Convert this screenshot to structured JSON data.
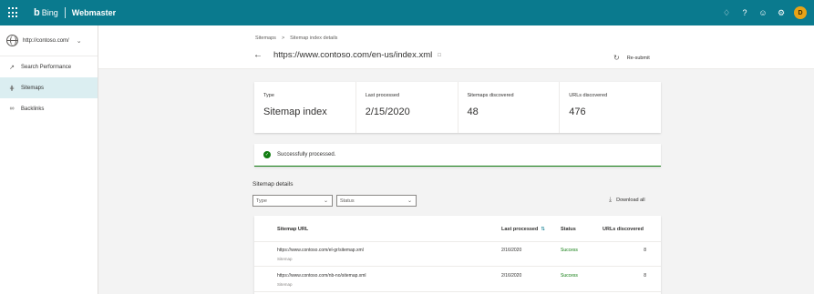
{
  "topbar": {
    "brand": "Bing",
    "product": "Webmaster",
    "avatar_initial": "D",
    "colors": {
      "bar": "#0a7a8e",
      "avatar": "#e8a317"
    }
  },
  "sidebar": {
    "site": "http://contoso.com/",
    "items": [
      {
        "label": "Search Performance",
        "icon": "trend-icon",
        "active": false
      },
      {
        "label": "Sitemaps",
        "icon": "sitemap-icon",
        "active": true
      },
      {
        "label": "Backlinks",
        "icon": "link-icon",
        "active": false
      }
    ]
  },
  "header": {
    "breadcrumb": [
      "Sitemaps",
      "Sitemap index details"
    ],
    "breadcrumb_sep": ">",
    "url": "https://www.contoso.com/en-us/index.xml",
    "resubmit_label": "Re-submit"
  },
  "stats": [
    {
      "label": "Type",
      "value": "Sitemap index"
    },
    {
      "label": "Last processed",
      "value": "2/15/2020"
    },
    {
      "label": "Sitemaps discovered",
      "value": "48"
    },
    {
      "label": "URLs discovered",
      "value": "476"
    }
  ],
  "message": {
    "text": "Successfully processed.",
    "color": "#107c10"
  },
  "details": {
    "title": "Sitemap details",
    "filters": [
      {
        "label": "Type"
      },
      {
        "label": "Status"
      }
    ],
    "download_label": "Download all",
    "columns": {
      "url": "Sitemap URL",
      "last_processed": "Last processed",
      "status": "Status",
      "urls": "URLs discovered"
    },
    "rows": [
      {
        "url": "https://www.contoso.com/el-gr/sitemap.xml",
        "type": "Sitemap",
        "date": "2/16/2020",
        "status": "Success",
        "count": "8"
      },
      {
        "url": "https://www.contoso.com/nb-no/sitemap.xml",
        "type": "Sitemap",
        "date": "2/16/2020",
        "status": "Success",
        "count": "8"
      }
    ]
  }
}
